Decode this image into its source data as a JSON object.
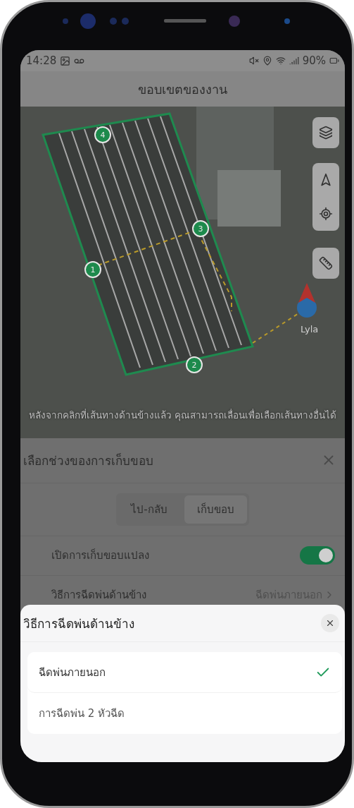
{
  "status_bar": {
    "time": "14:28",
    "battery": "90%"
  },
  "header": {
    "title": "ขอบเขตของงาน"
  },
  "map": {
    "markers": [
      "4",
      "3",
      "1",
      "2"
    ],
    "location_label": "Lyla",
    "hint": "หลังจากคลิกที่เส้นทางด้านข้างแล้ว คุณสามารถเลื่อนเพื่อเลือกเส้นทางอื่นได้"
  },
  "panel": {
    "title": "เลือกช่วงของการเก็บขอบ",
    "tabs": [
      {
        "label": "ไป-กลับ",
        "selected": false
      },
      {
        "label": "เก็บขอบ",
        "selected": true
      }
    ],
    "settings": [
      {
        "kind": "toggle",
        "label": "เปิดการเก็บขอบแปลง",
        "on": true
      },
      {
        "kind": "select",
        "label": "วิธีการฉีดพ่นด้านข้าง",
        "value": "ฉีดพ่นภายนอก"
      }
    ]
  },
  "sheet": {
    "title": "วิธีการฉีดพ่นด้านข้าง",
    "options": [
      {
        "label": "ฉีดพ่นภายนอก",
        "selected": true
      },
      {
        "label": "การฉีดพ่น 2 หัวฉีด",
        "selected": false
      }
    ]
  }
}
